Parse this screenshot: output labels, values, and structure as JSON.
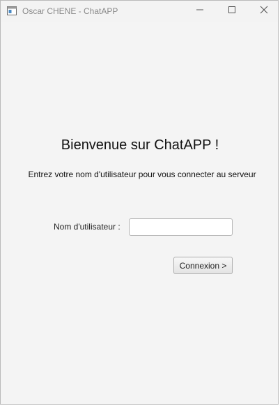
{
  "window": {
    "title": "Oscar CHENE - ChatAPP",
    "icon": "app-window-icon",
    "controls": {
      "minimize_icon": "minimize-icon",
      "maximize_icon": "maximize-icon",
      "close_icon": "close-icon"
    }
  },
  "main": {
    "heading": "Bienvenue sur ChatAPP !",
    "subtitle": "Entrez votre nom d'utilisateur pour vous connecter au serveur",
    "username_label": "Nom d'utilisateur :",
    "username_value": "",
    "connect_button": "Connexion >"
  },
  "colors": {
    "background": "#f4f4f4",
    "titlebar": "#f3f3f3",
    "title_text": "#8a8a8a"
  }
}
